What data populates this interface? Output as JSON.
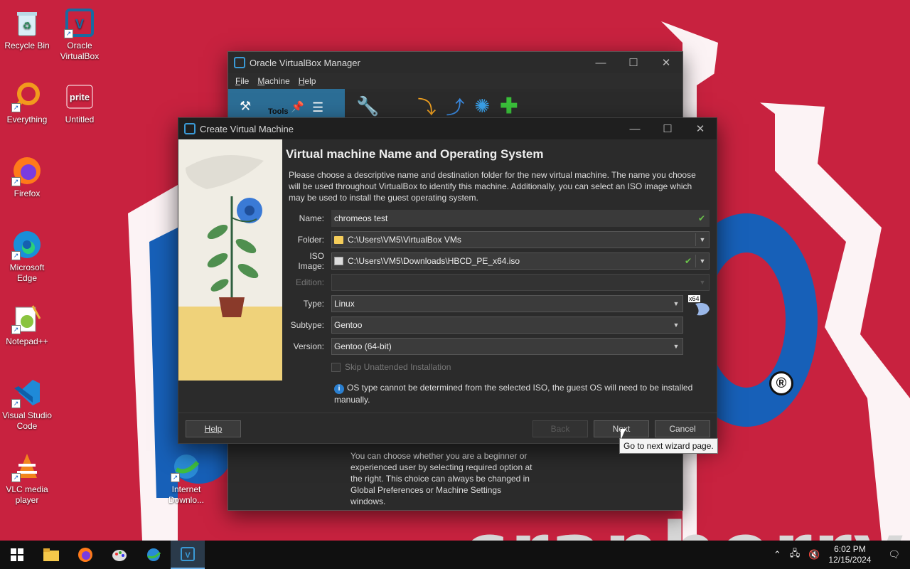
{
  "desktop": {
    "icons": [
      {
        "label": "Recycle Bin",
        "icon": "recycle-bin-icon"
      },
      {
        "label": "Oracle VirtualBox",
        "icon": "virtualbox-icon"
      },
      {
        "label": "Everything",
        "icon": "everything-search-icon"
      },
      {
        "label": "Untitled",
        "icon": "sprite-document-icon"
      },
      {
        "label": "Firefox",
        "icon": "firefox-icon"
      },
      {
        "label": "Microsoft Edge",
        "icon": "edge-icon"
      },
      {
        "label": "Notepad++",
        "icon": "notepadpp-icon"
      },
      {
        "label": "Visual Studio Code",
        "icon": "vscode-icon"
      },
      {
        "label": "VLC media player",
        "icon": "vlc-icon"
      },
      {
        "label": "Internet Downlo...",
        "icon": "internet-download-manager-icon"
      }
    ],
    "wallpaper_text": "cranberry",
    "registered_mark": "®",
    "colors": {
      "wallpaper": "#c8223f",
      "accent_blue": "#1560c0"
    }
  },
  "manager": {
    "title": "Oracle VirtualBox Manager",
    "menu": [
      "File",
      "Machine",
      "Help"
    ],
    "tools_label": "Tools",
    "tip_text": "You can choose whether you are a beginner or experienced user by selecting required option at the right. This choice can always be changed in Global Preferences or Machine Settings windows."
  },
  "dialog": {
    "title": "Create Virtual Machine",
    "heading": "Virtual machine Name and Operating System",
    "description": "Please choose a descriptive name and destination folder for the new virtual machine. The name you choose will be used throughout VirtualBox to identify this machine. Additionally, you can select an ISO image which may be used to install the guest operating system.",
    "labels": {
      "name": "Name:",
      "folder": "Folder:",
      "iso": "ISO Image:",
      "edition": "Edition:",
      "type": "Type:",
      "subtype": "Subtype:",
      "version": "Version:"
    },
    "values": {
      "name": "chromeos test",
      "folder": "C:\\Users\\VM5\\VirtualBox VMs",
      "iso": "C:\\Users\\VM5\\Downloads\\HBCD_PE_x64.iso",
      "edition": "",
      "type": "Linux",
      "subtype": "Gentoo",
      "version": "Gentoo (64-bit)"
    },
    "os_badge": "x64",
    "skip_unattended": "Skip Unattended Installation",
    "info": "OS type cannot be determined from the selected ISO, the guest OS will need to be installed manually.",
    "buttons": {
      "help": "Help",
      "back": "Back",
      "next": "Next",
      "cancel": "Cancel"
    },
    "tooltip": "Go to next wizard page."
  },
  "taskbar": {
    "items": [
      "start-icon",
      "file-explorer-icon",
      "firefox-icon",
      "paint-icon",
      "internet-download-manager-icon",
      "virtualbox-icon"
    ],
    "time": "6:02 PM",
    "date": "12/15/2024"
  }
}
